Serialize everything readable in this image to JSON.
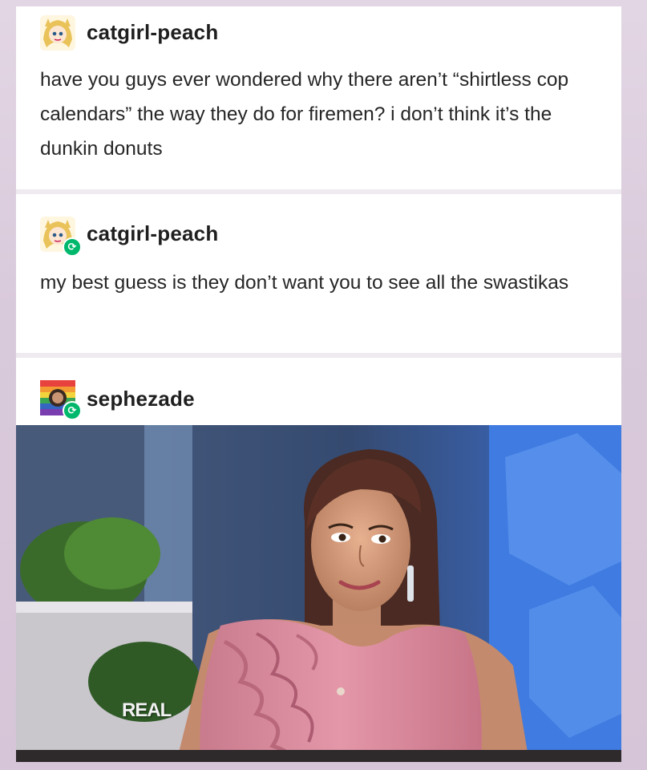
{
  "posts": [
    {
      "username": "catgirl-peach",
      "avatar_icon": "anime-avatar-icon",
      "text": "have you guys ever wondered why there aren’t “shirtless cop calendars” the way they do for firemen? i don’t think it’s the dunkin donuts"
    },
    {
      "username": "catgirl-peach",
      "avatar_icon": "anime-avatar-icon",
      "reblog_icon": "reblog-badge-icon",
      "text": "my best guess is they don’t want you to see all the swastikas"
    },
    {
      "username": "sephezade",
      "avatar_icon": "pixel-avatar-icon",
      "reblog_icon": "reblog-badge-icon"
    }
  ],
  "image": {
    "watermark": "REAL"
  },
  "colors": {
    "page_bg": "#dacbdc",
    "card_bg": "#ffffff",
    "reblog_green": "#00b86b",
    "dress_pink": "#d9889a"
  }
}
